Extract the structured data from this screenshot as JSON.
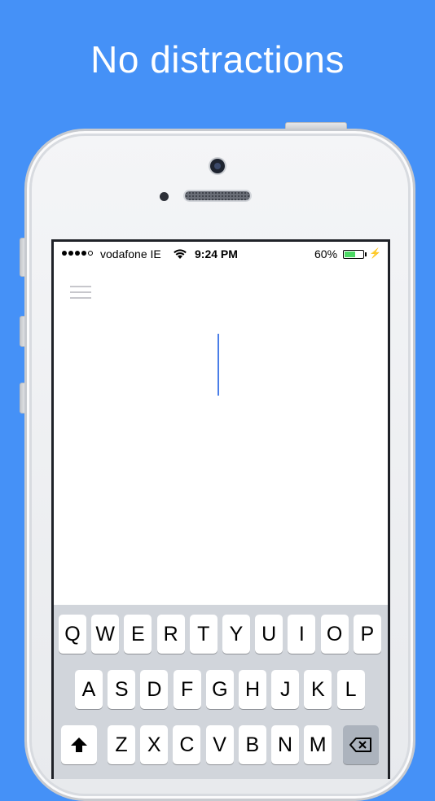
{
  "headline": "No distractions",
  "status_bar": {
    "carrier": "vodafone IE",
    "time": "9:24 PM",
    "battery_percent": "60%",
    "battery_level": 0.6,
    "signal_bars_filled": 4,
    "signal_bars_total": 5
  },
  "editor": {
    "menu_icon": "hamburger-menu-icon",
    "cursor_color": "#4a7ee8"
  },
  "keyboard": {
    "row1": [
      "Q",
      "W",
      "E",
      "R",
      "T",
      "Y",
      "U",
      "I",
      "O",
      "P"
    ],
    "row2": [
      "A",
      "S",
      "D",
      "F",
      "G",
      "H",
      "J",
      "K",
      "L"
    ],
    "row3": [
      "Z",
      "X",
      "C",
      "V",
      "B",
      "N",
      "M"
    ],
    "shift_icon": "shift-arrow-icon",
    "delete_icon": "backspace-icon"
  },
  "colors": {
    "background": "#4591f7",
    "battery_fill": "#4cd964",
    "keyboard_bg": "#d1d5db"
  }
}
